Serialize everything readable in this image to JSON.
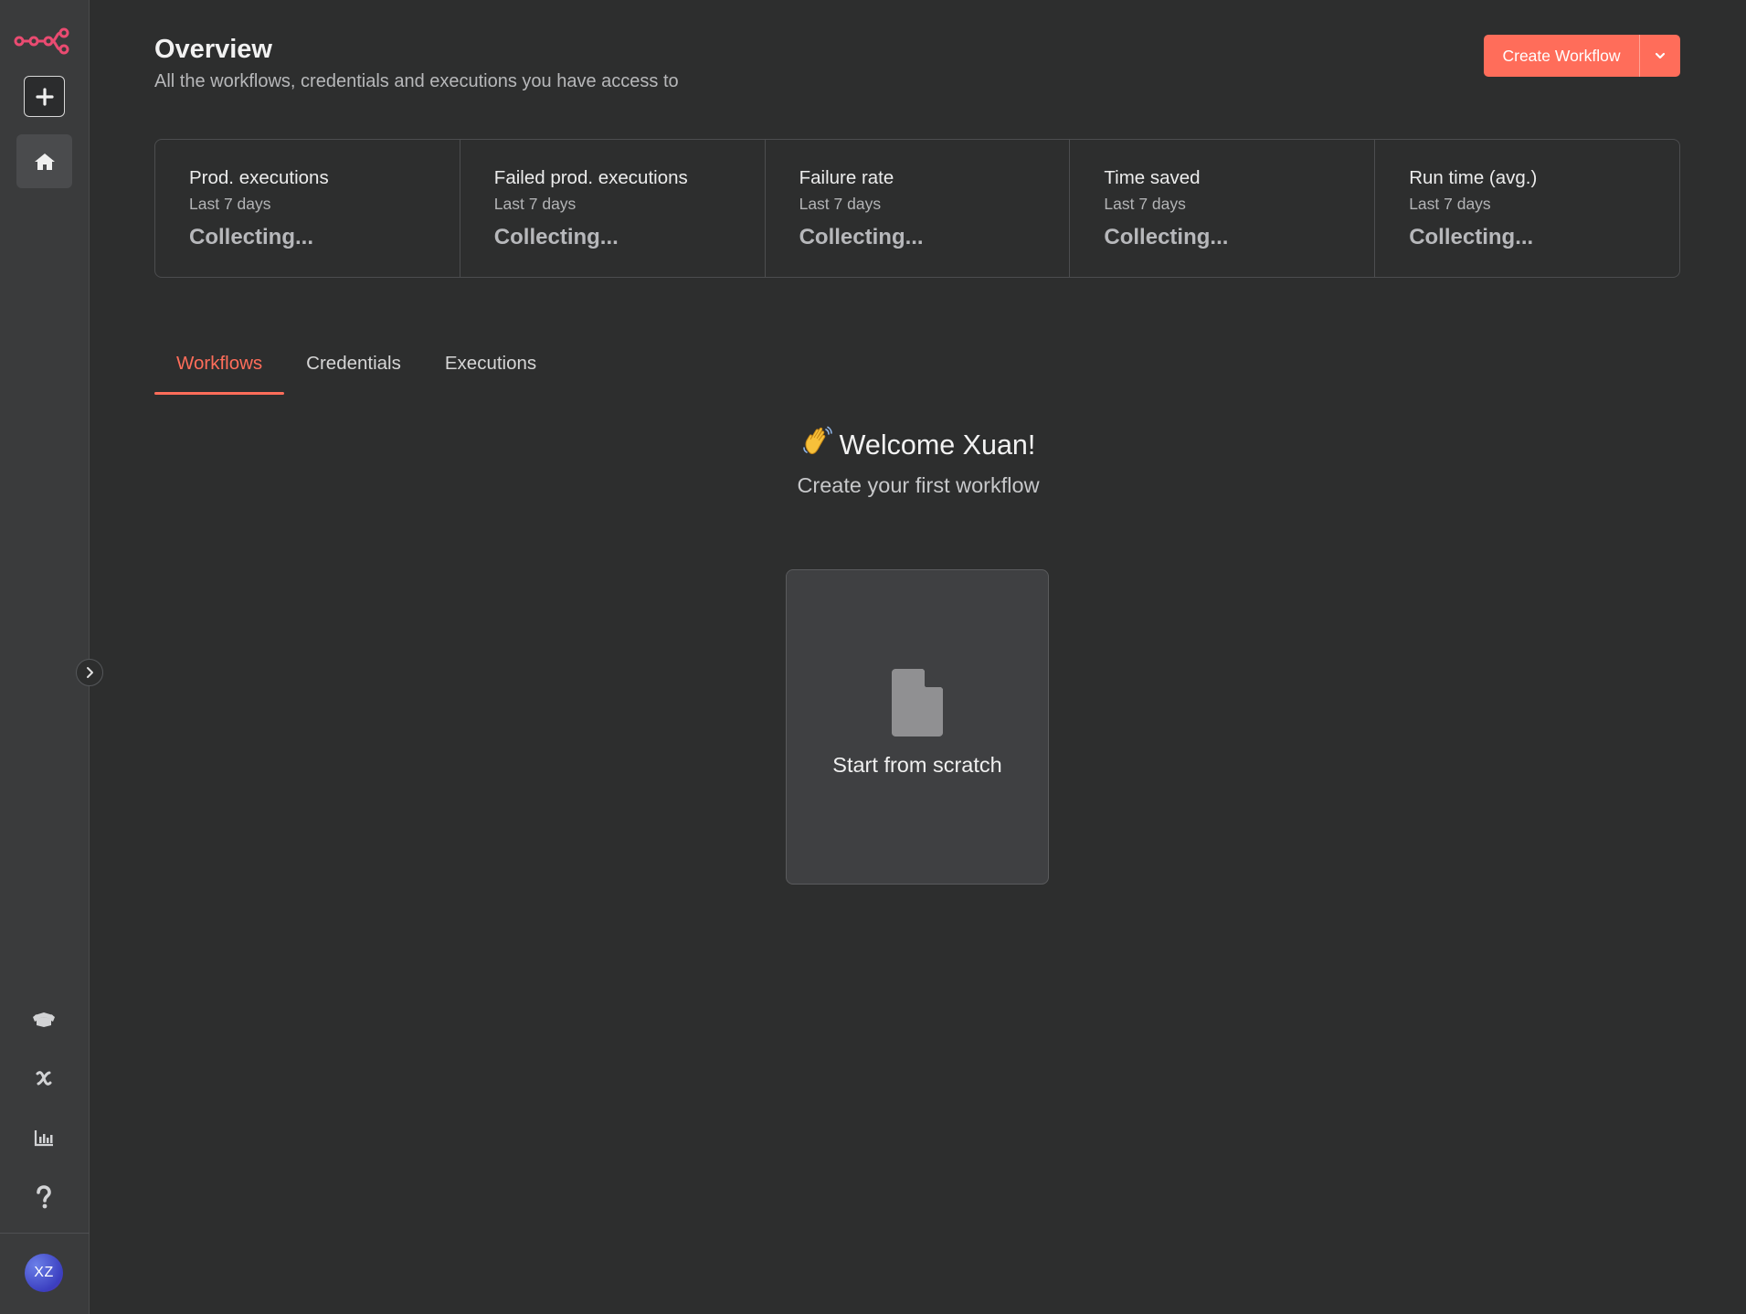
{
  "sidebar": {
    "avatar_initials": "XZ"
  },
  "header": {
    "title": "Overview",
    "subtitle": "All the workflows, credentials and executions you have access to",
    "create_label": "Create Workflow"
  },
  "stats": [
    {
      "title": "Prod. executions",
      "period": "Last 7 days",
      "value": "Collecting..."
    },
    {
      "title": "Failed prod. executions",
      "period": "Last 7 days",
      "value": "Collecting..."
    },
    {
      "title": "Failure rate",
      "period": "Last 7 days",
      "value": "Collecting..."
    },
    {
      "title": "Time saved",
      "period": "Last 7 days",
      "value": "Collecting..."
    },
    {
      "title": "Run time (avg.)",
      "period": "Last 7 days",
      "value": "Collecting..."
    }
  ],
  "tabs": [
    {
      "label": "Workflows",
      "active": true
    },
    {
      "label": "Credentials",
      "active": false
    },
    {
      "label": "Executions",
      "active": false
    }
  ],
  "empty_state": {
    "welcome": "Welcome Xuan!",
    "subtitle": "Create your first workflow",
    "card_label": "Start from scratch"
  },
  "colors": {
    "accent": "#ff6d5a",
    "background": "#2d2e2e",
    "sidebar": "#3a3b3c",
    "logo": "#ea4b71"
  },
  "icons": {
    "logo": "n8n-logo-icon",
    "add": "plus-icon",
    "home": "home-icon",
    "expand": "chevron-right-icon",
    "templates": "box-open-icon",
    "variables": "variable-x-icon",
    "insights": "bar-chart-icon",
    "help": "question-icon",
    "dropdown": "chevron-down-icon",
    "wave": "waving-hand-icon",
    "file": "file-icon"
  }
}
